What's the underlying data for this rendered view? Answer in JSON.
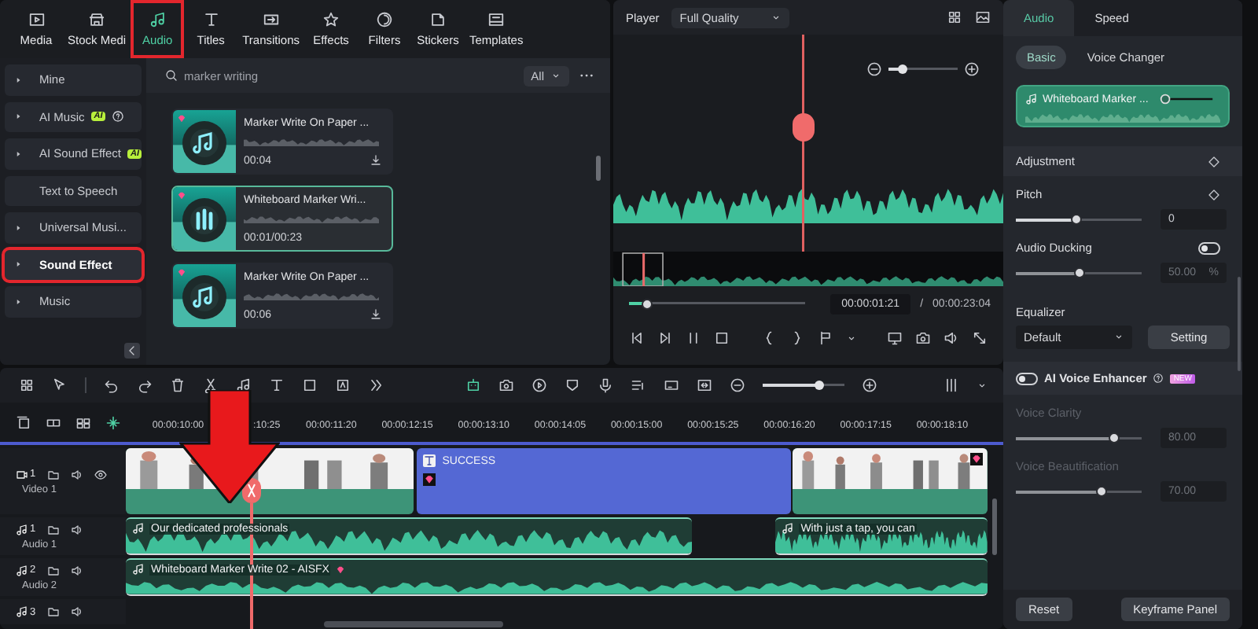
{
  "library_tabs": [
    {
      "label": "Media",
      "selected": false,
      "highlighted": false
    },
    {
      "label": "Stock Medi",
      "selected": false,
      "highlighted": false
    },
    {
      "label": "Audio",
      "selected": true,
      "highlighted": true
    },
    {
      "label": "Titles",
      "selected": false,
      "highlighted": false
    },
    {
      "label": "Transitions",
      "selected": false,
      "highlighted": false
    },
    {
      "label": "Effects",
      "selected": false,
      "highlighted": false
    },
    {
      "label": "Filters",
      "selected": false,
      "highlighted": false
    },
    {
      "label": "Stickers",
      "selected": false,
      "highlighted": false
    },
    {
      "label": "Templates",
      "selected": false,
      "highlighted": false
    }
  ],
  "sidebar": {
    "items": [
      {
        "label": "Mine",
        "expandable": true,
        "help": false,
        "selected": false,
        "highlighted": false
      },
      {
        "label": "AI Music",
        "badge": "AI",
        "expandable": true,
        "help": true,
        "selected": false,
        "highlighted": false
      },
      {
        "label": "AI Sound Effect",
        "badge": "AI",
        "expandable": true,
        "help": false,
        "selected": false,
        "highlighted": false
      },
      {
        "label": "Text to Speech",
        "expandable": false,
        "help": false,
        "selected": false,
        "highlighted": false
      },
      {
        "label": "Universal Musi...",
        "expandable": true,
        "help": false,
        "selected": false,
        "highlighted": false
      },
      {
        "label": "Sound Effect",
        "expandable": true,
        "help": false,
        "selected": true,
        "highlighted": true
      },
      {
        "label": "Music",
        "expandable": true,
        "help": false,
        "selected": false,
        "highlighted": false
      }
    ]
  },
  "search": {
    "value": "marker writing",
    "filter": "All"
  },
  "results": [
    {
      "title": "Marker Write On Paper ...",
      "duration": "00:04",
      "premium": true,
      "playing": false,
      "download": true,
      "selected": false
    },
    {
      "title": "Whiteboard Marker Wri...",
      "duration": "00:01/00:23",
      "premium": true,
      "playing": true,
      "download": false,
      "selected": true
    },
    {
      "title": "Marker Write On Paper ...",
      "duration": "00:06",
      "premium": true,
      "playing": false,
      "download": true,
      "selected": false
    }
  ],
  "player": {
    "label": "Player",
    "quality": "Full Quality",
    "zoom": {
      "level": 0.2
    },
    "progress": {
      "level": 0.1
    },
    "current_time": "00:00:01:21",
    "separator": "/",
    "total_time": "00:00:23:04"
  },
  "inspector": {
    "tabs": [
      {
        "label": "Audio",
        "selected": true
      },
      {
        "label": "Speed",
        "selected": false
      }
    ],
    "subtabs": [
      {
        "label": "Basic",
        "selected": true
      },
      {
        "label": "Voice Changer",
        "selected": false
      }
    ],
    "clip_title": "Whiteboard Marker ...",
    "clip_volume": {
      "level": 0.05
    },
    "adjustment": "Adjustment",
    "pitch": {
      "label": "Pitch",
      "level": 0.48,
      "value": "0"
    },
    "ducking": {
      "label": "Audio Ducking",
      "on": false,
      "level": 0.5,
      "value": "50.00",
      "unit": "%"
    },
    "equalizer": {
      "label": "Equalizer",
      "preset": "Default",
      "button": "Setting"
    },
    "enhancer": {
      "label": "AI Voice Enhancer",
      "on": false,
      "badge": "NEW"
    },
    "enhancer_sliders": [
      {
        "label": "Voice Clarity",
        "level": 0.78,
        "value": "80.00",
        "disabled": true
      },
      {
        "label": "Voice Beautification",
        "level": 0.68,
        "value": "70.00",
        "disabled": true
      }
    ],
    "buttons": [
      "Reset",
      "Keyframe Panel"
    ]
  },
  "timeline": {
    "zoom": {
      "level": 0.7
    },
    "ruler": [
      "00:00:10:00",
      ":10:25",
      "00:00:11:20",
      "00:00:12:15",
      "00:00:13:10",
      "00:00:14:05",
      "00:00:15:00",
      "00:00:15:25",
      "00:00:16:20",
      "00:00:17:15",
      "00:00:18:10"
    ],
    "tracks": [
      {
        "kind": "video",
        "number": "1",
        "name": "Video 1",
        "clips": [
          {
            "kind": "video",
            "premium": false
          },
          {
            "kind": "title",
            "title": "SUCCESS",
            "premium": true
          },
          {
            "kind": "video",
            "premium": true
          }
        ]
      },
      {
        "kind": "audio",
        "number": "1",
        "name": "Audio 1",
        "clips": [
          {
            "kind": "audio",
            "title": "Our dedicated professionals",
            "premium": false
          },
          {
            "kind": "audio",
            "title": "With just a tap, you can",
            "premium": false
          }
        ]
      },
      {
        "kind": "audio",
        "number": "2",
        "name": "Audio 2",
        "clips": [
          {
            "kind": "audio",
            "title": "Whiteboard Marker Write 02 - AISFX",
            "premium": true
          }
        ]
      },
      {
        "kind": "audio",
        "number": "3"
      }
    ]
  }
}
